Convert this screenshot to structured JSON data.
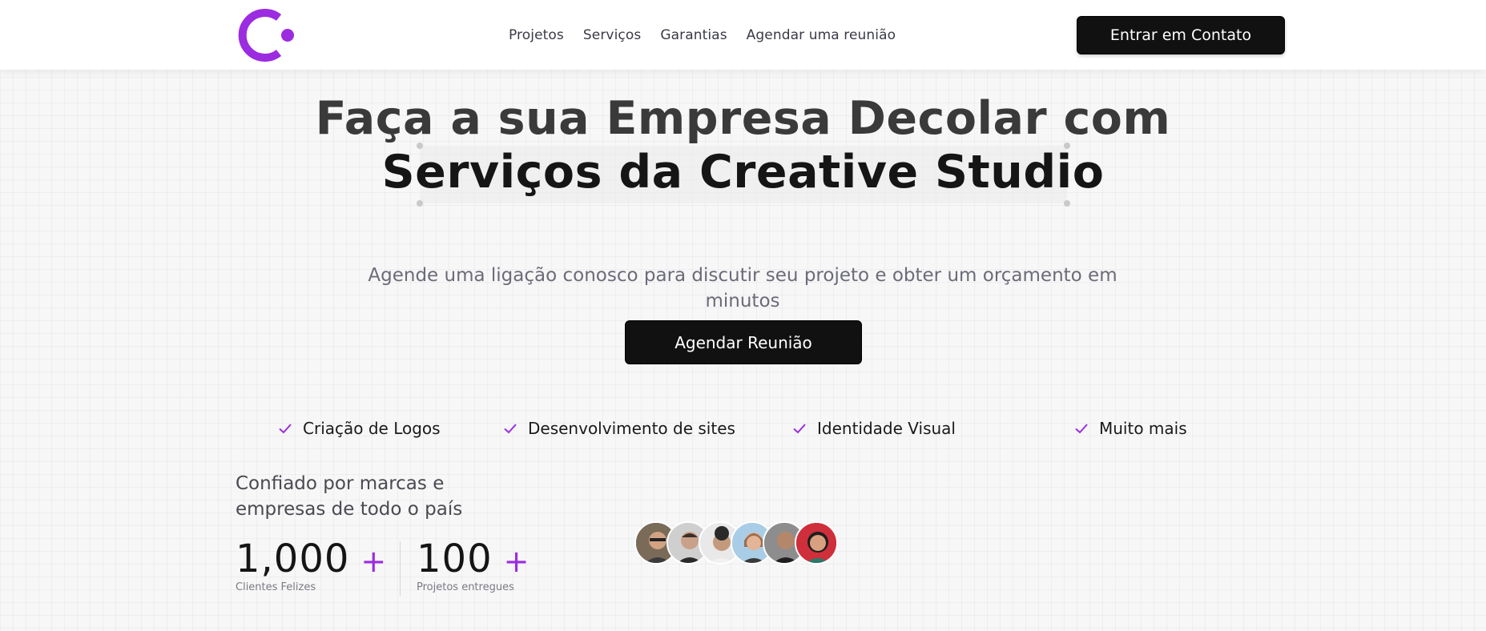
{
  "header": {
    "logo_name": "brand-logo",
    "nav": [
      {
        "label": "Projetos"
      },
      {
        "label": "Serviços"
      },
      {
        "label": "Garantias"
      },
      {
        "label": "Agendar uma reunião"
      }
    ],
    "contact_label": "Entrar em Contato"
  },
  "hero": {
    "title_line1": "Faça a sua Empresa Decolar com",
    "title_line2": "Serviços da Creative Studio",
    "subtitle": "Agende uma ligação conosco para discutir seu projeto e obter um orçamento em minutos",
    "cta_label": "Agendar Reunião"
  },
  "features": [
    {
      "label": "Criação de Logos",
      "icon": "check-icon"
    },
    {
      "label": "Desenvolvimento de sites",
      "icon": "check-icon"
    },
    {
      "label": "Identidade Visual",
      "icon": "check-icon"
    },
    {
      "label": "Muito mais",
      "icon": "check-icon"
    }
  ],
  "trust": {
    "text": "Confiado por marcas e empresas de todo o país",
    "stats": [
      {
        "value": "1,000",
        "suffix": "+",
        "label": "Clientes Felizes"
      },
      {
        "value": "100",
        "suffix": "+",
        "label": "Projetos entregues"
      }
    ],
    "avatar_count": 6
  },
  "colors": {
    "accent": "#9b2ce0",
    "button_bg": "#111111",
    "page_bg": "#f7f7f7"
  }
}
